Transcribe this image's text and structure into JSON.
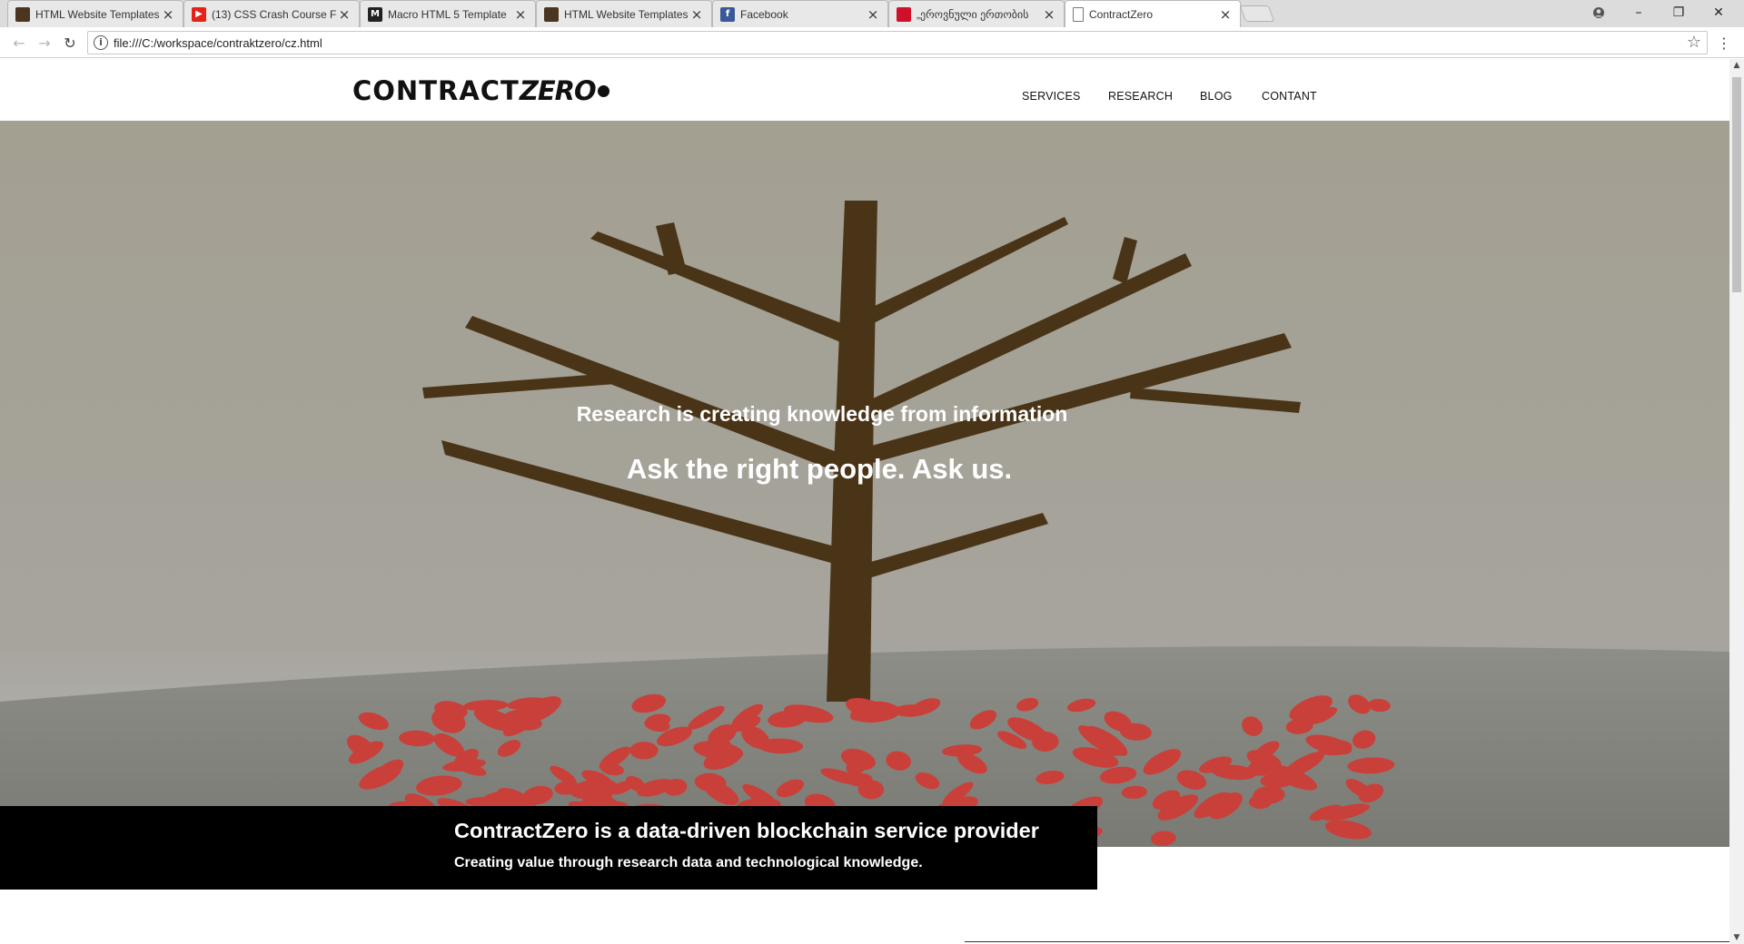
{
  "browser": {
    "tabs": [
      {
        "title": "HTML Website Templates",
        "icon": "template-site-icon",
        "icon_color": "#4a3520",
        "icon_text": "",
        "active": false
      },
      {
        "title": "(13) CSS Crash Course Fo",
        "icon": "youtube-icon",
        "icon_color": "#e62117",
        "icon_text": "▶",
        "active": false
      },
      {
        "title": "Macro HTML 5 Template",
        "icon": "macro-m-icon",
        "icon_color": "#222222",
        "icon_text": "M",
        "active": false
      },
      {
        "title": "HTML Website Templates",
        "icon": "template-site-icon",
        "icon_color": "#4a3520",
        "icon_text": "",
        "active": false
      },
      {
        "title": "Facebook",
        "icon": "facebook-icon",
        "icon_color": "#3b5998",
        "icon_text": "f",
        "active": false
      },
      {
        "title": "„ეროვნული ერთობის",
        "icon": "red-quill-icon",
        "icon_color": "#d0102a",
        "icon_text": "",
        "active": false
      },
      {
        "title": "ContractZero",
        "icon": "page-icon",
        "icon_color": "#ffffff",
        "icon_text": "",
        "active": true
      }
    ],
    "url": "file:///C:/workspace/contraktzero/cz.html"
  },
  "site": {
    "logo_main": "CONTRACT",
    "logo_zero": "ZERO",
    "nav": [
      "SERVICES",
      "RESEARCH",
      "BLOG",
      "CONTANT"
    ],
    "hero_line1": "Research is creating knowledge from information",
    "hero_line2": "Ask the right people. Ask us.",
    "banner_title": "ContractZero is a data-driven blockchain service provider",
    "banner_subtitle": "Creating value through research data and technological knowledge."
  },
  "colors": {
    "hero_sky": "#a3a092",
    "tree_trunk": "#4a3418",
    "leaves": "#c9403a",
    "ground": "#8b8b85",
    "banner_bg": "#000000"
  }
}
